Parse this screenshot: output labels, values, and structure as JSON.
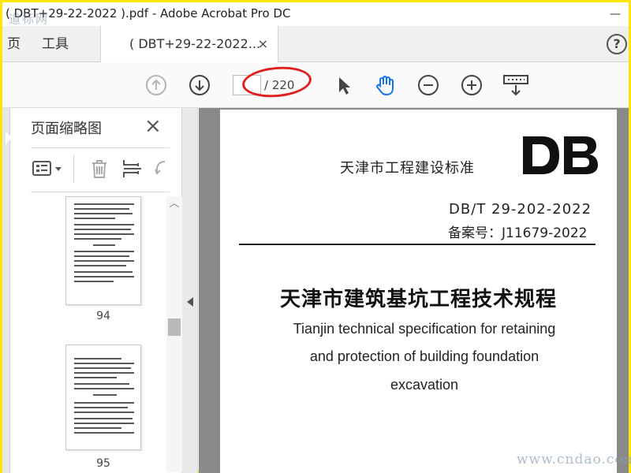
{
  "window": {
    "title": "( DBT+29-22-2022 ).pdf - Adobe Acrobat Pro DC",
    "watermark_top_left": "道标网"
  },
  "tabs": {
    "home_fragment": "页",
    "tools": "工具",
    "doc_tab": "( DBT+29-22-2022...",
    "doc_tab_close": "×",
    "help": "?"
  },
  "toolbar": {
    "page_current": "",
    "page_total": "/ 220",
    "icons": [
      "arrow-up-circle-icon",
      "arrow-down-circle-icon",
      "select-pointer-icon",
      "hand-tool-icon",
      "zoom-out-icon",
      "zoom-in-icon",
      "keyboard-scroll-icon"
    ],
    "highlight_color": "#e02020"
  },
  "sidepanel": {
    "title": "页面缩略图",
    "close": "×",
    "thumbnails": [
      {
        "label": "94"
      },
      {
        "label": "95"
      }
    ]
  },
  "document": {
    "std_org": "天津市工程建设标准",
    "logo_text": "DB",
    "std_number": "DB/T 29-202-2022",
    "record_number": "备案号：J11679-2022",
    "title_cn": "天津市建筑基坑工程技术规程",
    "title_en_lines": [
      "Tianjin technical specification for retaining",
      "and protection of building foundation",
      "excavation"
    ]
  },
  "watermark_bottom_right": "www.cndao.com",
  "colors": {
    "frame": "#ffe600",
    "accent_blue": "#1473e6"
  }
}
